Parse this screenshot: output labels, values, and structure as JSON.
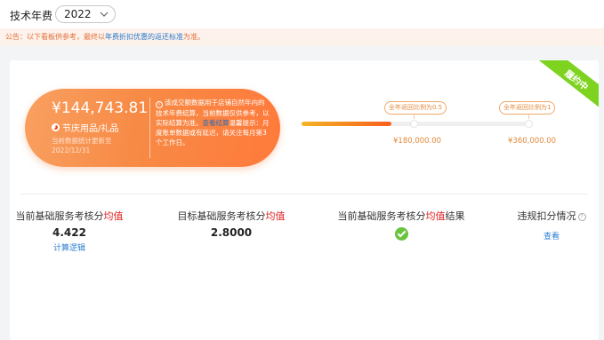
{
  "header": {
    "title": "技术年费",
    "year_select": {
      "value": "2022"
    }
  },
  "notice": {
    "prefix": "公告：以下看板供参考，最终以",
    "highlight": "年费折扣优惠的返还标准",
    "suffix": "为准。"
  },
  "status_ribbon": "履约中",
  "summary": {
    "amount": "¥144,743.81",
    "category": "节庆用品/礼品",
    "updated": "当前数据统计更新至2022/12/31",
    "desc_part1": "该成交额数据用于店铺自然年内的技术年费结算，当前数据仅供参考，以实际结算为准。",
    "desc_link": "查看结算",
    "desc_part2": "温馨提示：月度账单数据或有延迟，请关注每月第3个工作日。"
  },
  "progress": {
    "fraction": 0.39,
    "milestones": [
      {
        "label": "全年返回比例为0.5",
        "value": "¥180,000.00"
      },
      {
        "label": "全年返回比例为1",
        "value": "¥360,000.00"
      }
    ]
  },
  "metrics": {
    "current": {
      "label_prefix": "当前基础服务考核分",
      "label_red": "均值",
      "value": "4.422",
      "link": "计算逻辑"
    },
    "target": {
      "label_prefix": "目标基础服务考核分",
      "label_red": "均值",
      "value": "2.8000"
    },
    "result": {
      "label_prefix": "当前基础服务考核分",
      "label_red": "均值",
      "label_suffix": "结果"
    },
    "violation": {
      "label": "违规扣分情况",
      "link": "查看"
    }
  }
}
